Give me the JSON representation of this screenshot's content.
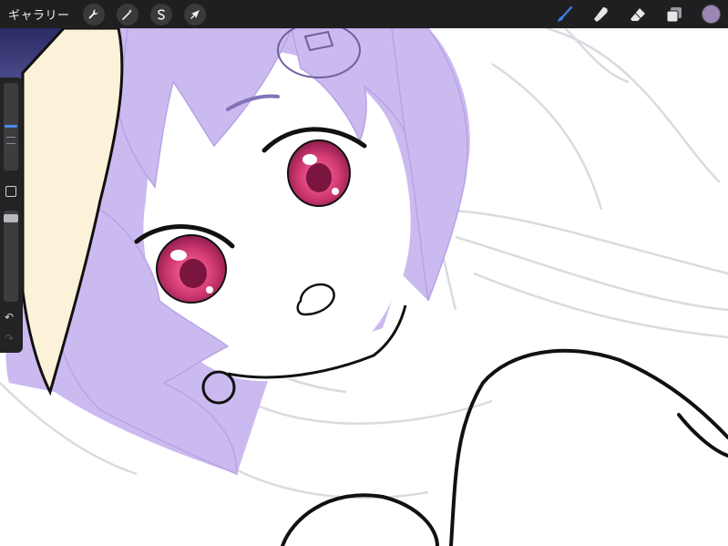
{
  "app": {
    "gallery_label": "ギャラリー"
  },
  "toolbar_left": [
    {
      "name": "actions",
      "icon": "wrench-icon"
    },
    {
      "name": "adjustments",
      "icon": "magic-wand-icon"
    },
    {
      "name": "selection",
      "icon": "selection-s-icon"
    },
    {
      "name": "transform",
      "icon": "arrow-cursor-icon"
    }
  ],
  "toolbar_right": [
    {
      "name": "brush",
      "icon": "brush-icon",
      "active": true
    },
    {
      "name": "smudge",
      "icon": "smudge-icon",
      "active": false
    },
    {
      "name": "eraser",
      "icon": "eraser-icon",
      "active": false
    },
    {
      "name": "layers",
      "icon": "layers-icon",
      "active": false
    }
  ],
  "current_color": "#9b86b4",
  "active_tool_color": "#3f7de8",
  "sidebar": {
    "undo_glyph": "↶",
    "redo_glyph": "↷"
  },
  "palette": {
    "hair": "#cbbaf0",
    "hair_shadow": "#b8a4e6",
    "skin": "#ffffff",
    "hat": "#fcf2da",
    "eye": "#e0447a",
    "line": "#111111",
    "sketch": "#d8d8de"
  }
}
